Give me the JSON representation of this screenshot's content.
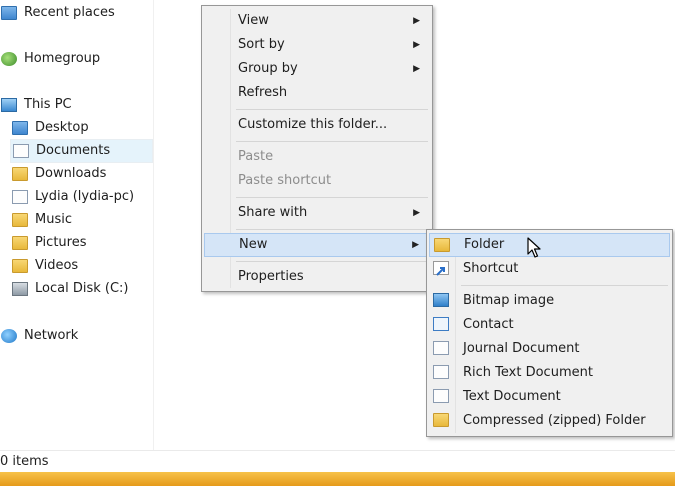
{
  "nav": {
    "recent_places": "Recent places",
    "homegroup": "Homegroup",
    "this_pc": "This PC",
    "desktop": "Desktop",
    "documents": "Documents",
    "downloads": "Downloads",
    "lydia": "Lydia (lydia-pc)",
    "music": "Music",
    "pictures": "Pictures",
    "videos": "Videos",
    "local_disk": "Local Disk (C:)",
    "network": "Network"
  },
  "status": {
    "items": "0 items"
  },
  "context_menu": {
    "view": "View",
    "sort_by": "Sort by",
    "group_by": "Group by",
    "refresh": "Refresh",
    "customize": "Customize this folder...",
    "paste": "Paste",
    "paste_shortcut": "Paste shortcut",
    "share_with": "Share with",
    "new": "New",
    "properties": "Properties"
  },
  "new_submenu": {
    "folder": "Folder",
    "shortcut": "Shortcut",
    "bitmap": "Bitmap image",
    "contact": "Contact",
    "journal": "Journal Document",
    "rtf": "Rich Text Document",
    "text": "Text Document",
    "zip": "Compressed (zipped) Folder"
  },
  "colors": {
    "highlight": "#d5e5f7",
    "menu_bg": "#f0f0f0",
    "selected_nav": "#e5f3fb"
  }
}
